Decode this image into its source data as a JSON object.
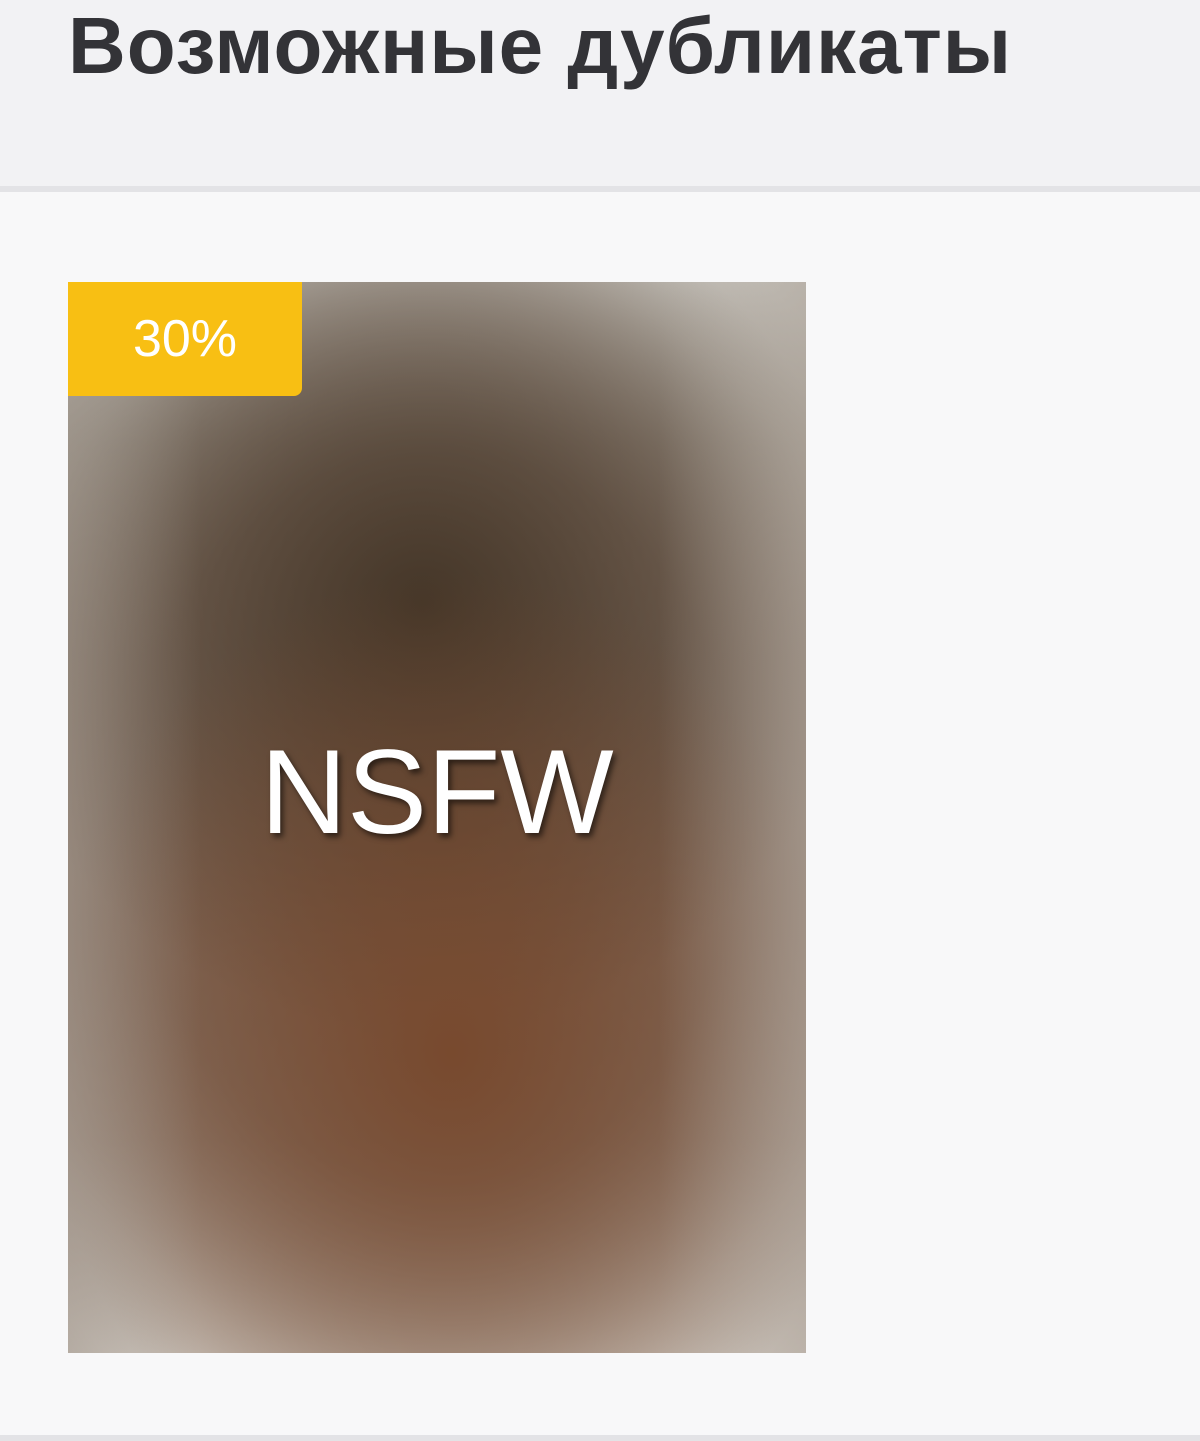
{
  "header": {
    "title": "Возможные дубликаты"
  },
  "duplicates": [
    {
      "similarity_label": "30%",
      "overlay_label": "NSFW"
    }
  ],
  "colors": {
    "badge": "#f8bf13",
    "title_text": "#333337",
    "header_bg": "#f2f2f4",
    "content_bg": "#f8f8f9"
  }
}
